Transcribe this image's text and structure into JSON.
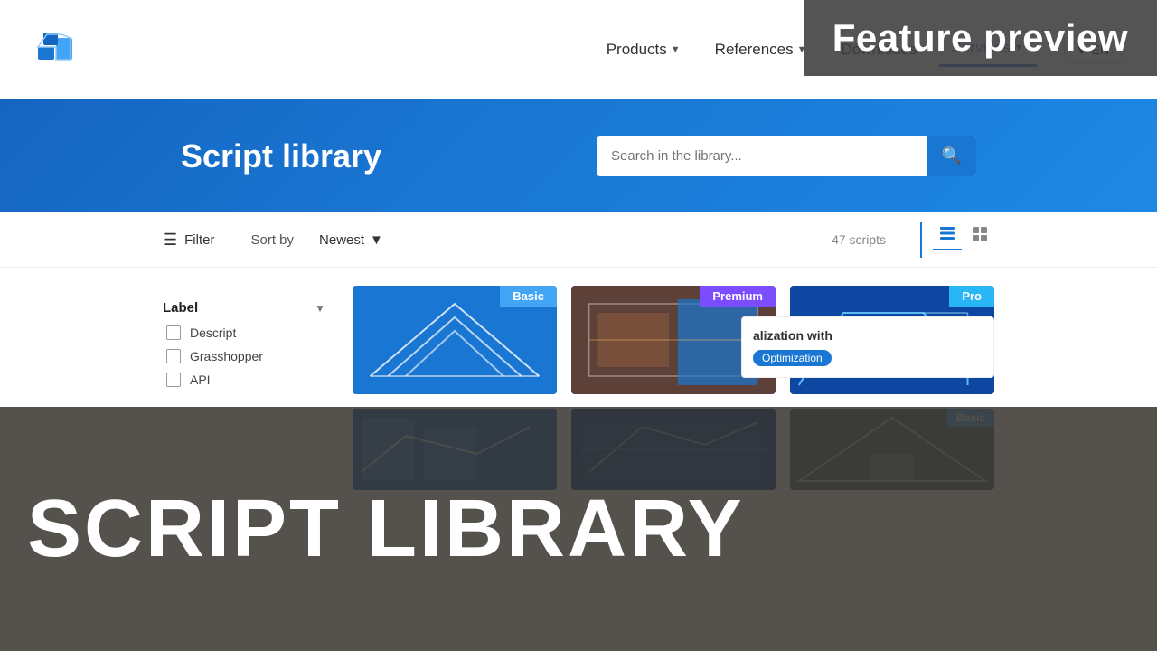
{
  "meta": {
    "title": "Script Library"
  },
  "header": {
    "logo_alt": "Consteel logo",
    "nav": [
      {
        "id": "products",
        "label": "Products",
        "has_dropdown": true,
        "active": false
      },
      {
        "id": "references",
        "label": "References",
        "has_dropdown": true,
        "active": false
      },
      {
        "id": "downloads",
        "label": "Downloads",
        "has_dropdown": false,
        "active": false
      },
      {
        "id": "services",
        "label": "Services",
        "has_dropdown": true,
        "active": true
      }
    ],
    "lang": "EN"
  },
  "feature_preview": {
    "label": "Feature preview"
  },
  "hero": {
    "title": "Script library",
    "search_placeholder": "Search in the library..."
  },
  "toolbar": {
    "filter_label": "Filter",
    "sort_label": "Sort by",
    "sort_value": "Newest",
    "scripts_count": "47 scripts",
    "view_list": "list-view",
    "view_grid": "grid-view"
  },
  "sidebar": {
    "sections": [
      {
        "id": "label",
        "title": "Label",
        "items": [
          {
            "id": "descript",
            "label": "Descript",
            "checked": false
          },
          {
            "id": "grasshopper",
            "label": "Grasshopper",
            "checked": false
          },
          {
            "id": "api",
            "label": "API",
            "checked": false
          }
        ]
      }
    ]
  },
  "cards": [
    {
      "id": "card-1",
      "badge": "Basic",
      "badge_class": "badge-basic",
      "visual_class": "visual-basic"
    },
    {
      "id": "card-2",
      "badge": "Premium",
      "badge_class": "badge-premium",
      "visual_class": "visual-premium"
    },
    {
      "id": "card-3",
      "badge": "Pro",
      "badge_class": "badge-pro",
      "visual_class": "visual-pro"
    }
  ],
  "bottom_cards": [
    {
      "id": "bottom-1",
      "visual_class": "bottom-visual-1",
      "badge": "",
      "badge_class": ""
    },
    {
      "id": "bottom-2",
      "visual_class": "bottom-visual-2",
      "badge": "",
      "badge_class": ""
    },
    {
      "id": "bottom-3",
      "visual_class": "bottom-visual-3",
      "badge": "Basic",
      "badge_class": "badge-basic"
    }
  ],
  "partial_card": {
    "title_suffix": "alization with",
    "tag": "Optimization"
  },
  "large_overlay": {
    "text": "SCRIPT LIBRARY"
  }
}
